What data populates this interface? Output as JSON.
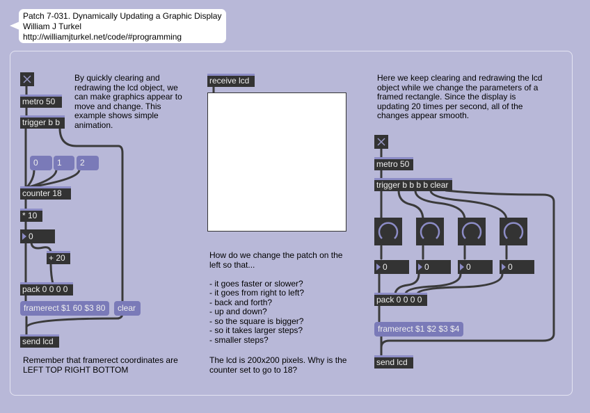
{
  "header": {
    "title": "Patch 7-031. Dynamically Updating a Graphic Display",
    "author": "William J Turkel",
    "url": "http://williamjturkel.net/code/#programming"
  },
  "left": {
    "comment_top": "By quickly clearing and redrawing the lcd object, we can make graphics appear to move and change. This example shows simple animation.",
    "metro": "metro 50",
    "trigger": "trigger b b",
    "msg_0": "0",
    "msg_1": "1",
    "msg_2": "2",
    "counter": "counter 18",
    "mult": "* 10",
    "num_val": "0",
    "add": "+ 20",
    "pack": "pack 0 0 0 0",
    "framerect": "framerect $1 60 $3 80",
    "clear": "clear",
    "send": "send lcd",
    "comment_bottom": "Remember that framerect coordinates are\nLEFT TOP RIGHT BOTTOM"
  },
  "middle": {
    "receive": "receive lcd",
    "question": "How do we change the patch on the left so that...\n\n- it goes faster or slower?\n- it goes from right to left?\n- back and forth?\n- up and down?\n- so the square is bigger?\n- so it takes larger steps?\n- smaller steps?",
    "note": "The lcd is 200x200 pixels. Why is the counter set to go to 18?"
  },
  "right": {
    "comment_top": "Here we keep clearing and redrawing the lcd object while we change the parameters of a framed rectangle. Since the display is updating 20 times per second, all of the changes appear smooth.",
    "metro": "metro 50",
    "trigger": "trigger b b b b clear",
    "num_1": "0",
    "num_2": "0",
    "num_3": "0",
    "num_4": "0",
    "pack": "pack 0 0 0 0",
    "framerect": "framerect $1 $2 $3 $4",
    "send": "send lcd"
  },
  "colors": {
    "background": "#b8b8d8",
    "object": "#333333",
    "message": "#7a7ab8",
    "inlet_accent": "#8c8cc6",
    "cord": "#333333",
    "lcd": "#ffffff"
  },
  "icons": {
    "toggle": "x-icon",
    "dial": "arc-dial-icon",
    "number_arrow": "triangle-right-icon"
  }
}
